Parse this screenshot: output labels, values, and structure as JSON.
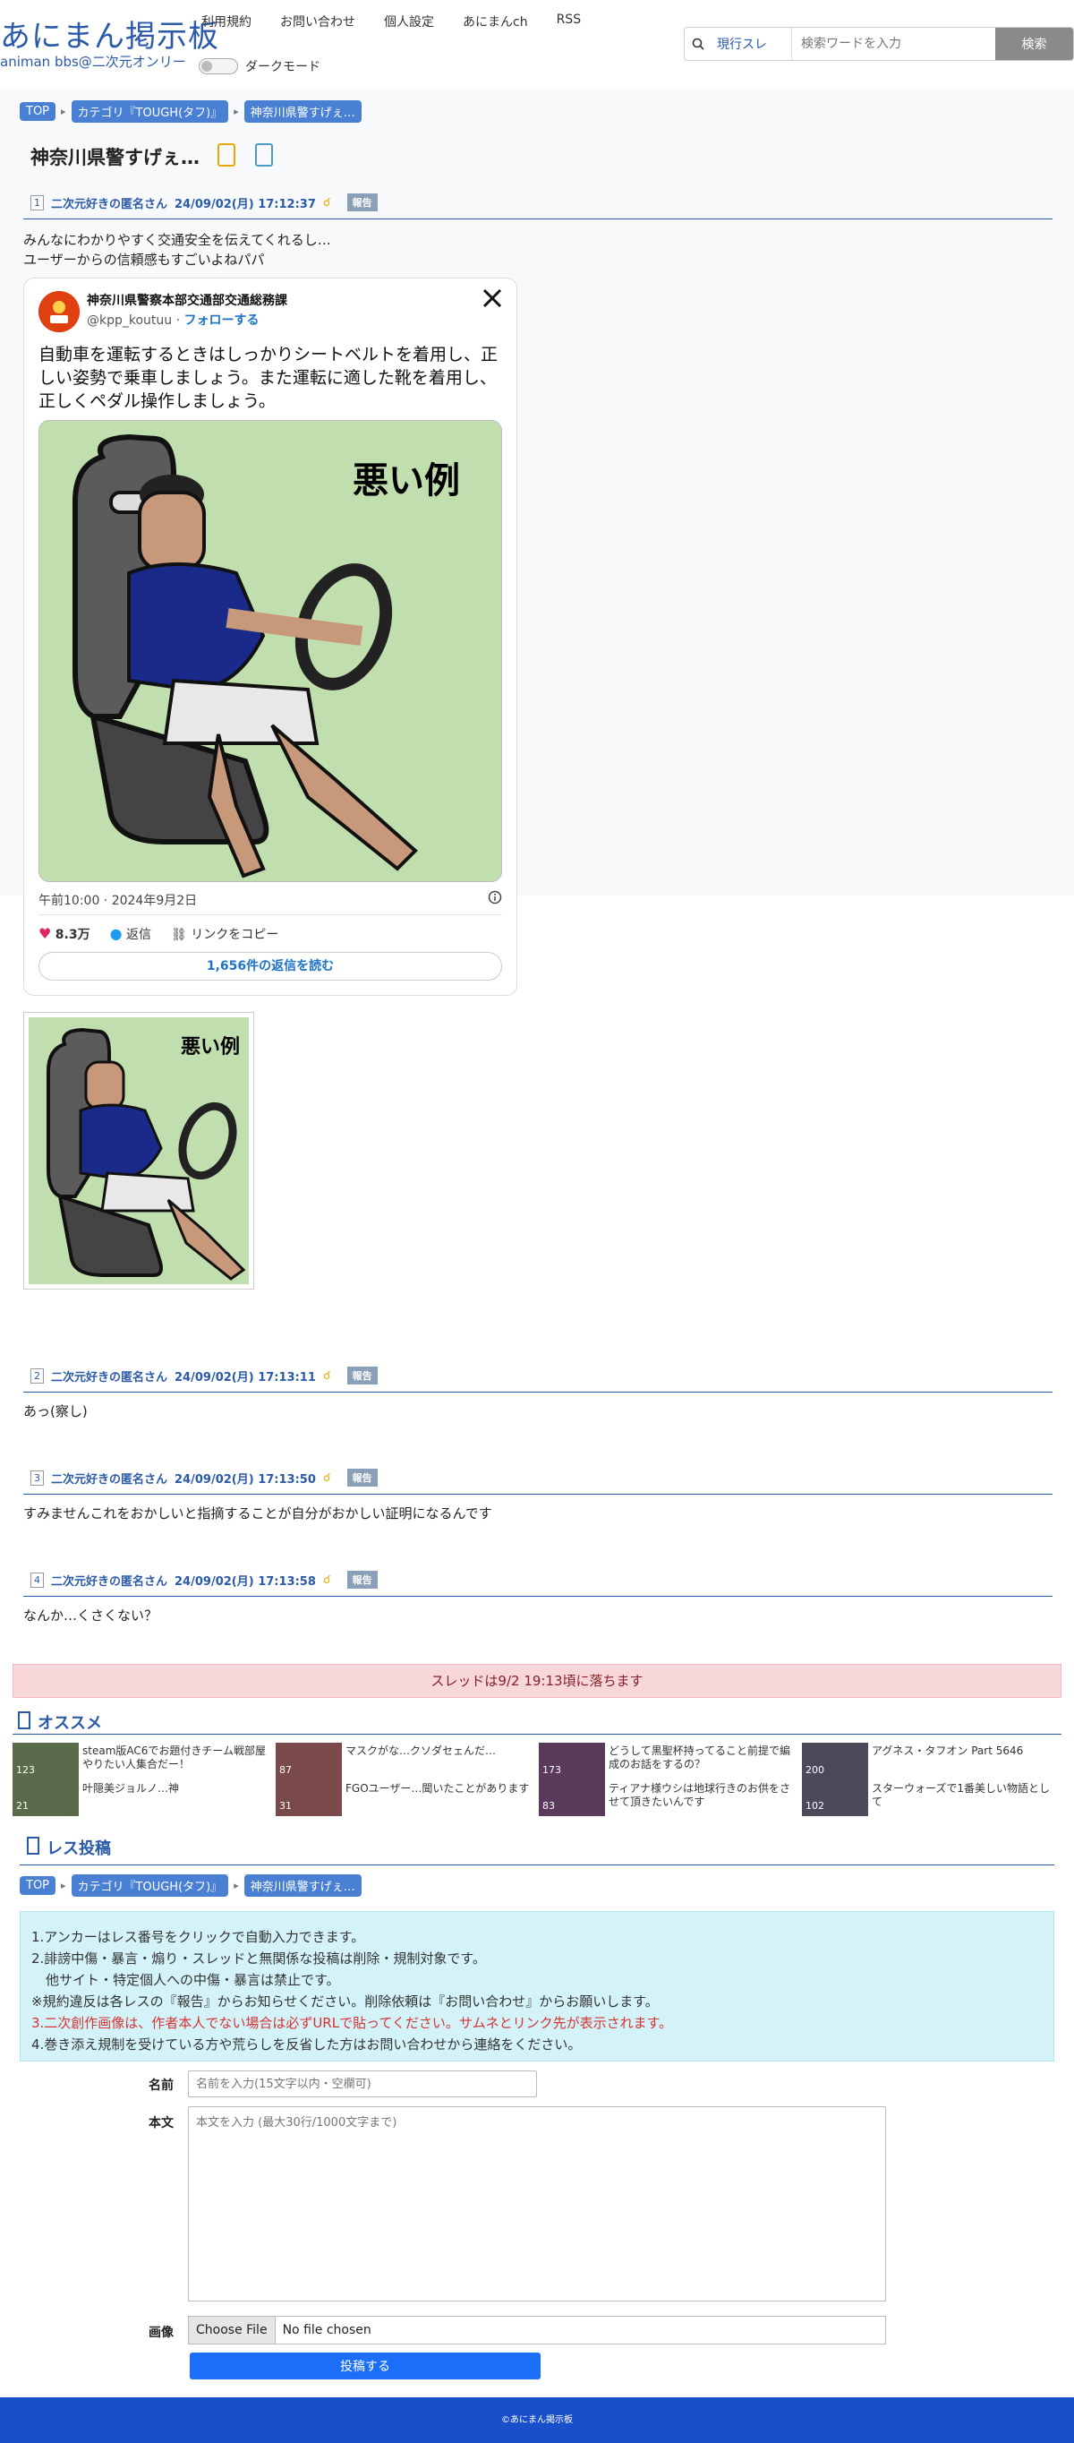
{
  "header": {
    "logo_main": "あにまん掲示板",
    "logo_sub": "animan bbs@二次元オンリー",
    "nav": [
      "利用規約",
      "お問い合わせ",
      "個人設定",
      "あにまんch",
      "RSS"
    ],
    "dark_mode_label": "ダークモード",
    "search_scope": "現行スレ",
    "search_placeholder": "検索ワードを入力",
    "search_button": "検索"
  },
  "breadcrumb": [
    "TOP",
    "カテゴリ『TOUGH(タフ)』",
    "神奈川県警すげぇ…"
  ],
  "thread": {
    "title": "神奈川県警すげぇ…",
    "expire_notice": "スレッドは9/2 19:13頃に落ちます"
  },
  "posts": [
    {
      "num": "1",
      "name": "二次元好きの匿名さん",
      "date": "24/09/02(月) 17:12:37",
      "report": "報告",
      "lines": [
        "みんなにわかりやすく交通安全を伝えてくれるし…",
        "ユーザーからの信頼感もすごいよねパパ"
      ]
    },
    {
      "num": "2",
      "name": "二次元好きの匿名さん",
      "date": "24/09/02(月) 17:13:11",
      "report": "報告",
      "lines": [
        "あっ(察し)"
      ]
    },
    {
      "num": "3",
      "name": "二次元好きの匿名さん",
      "date": "24/09/02(月) 17:13:50",
      "report": "報告",
      "lines": [
        "すみませんこれをおかしいと指摘することが自分がおかしい証明になるんです"
      ]
    },
    {
      "num": "4",
      "name": "二次元好きの匿名さん",
      "date": "24/09/02(月) 17:13:58",
      "report": "報告",
      "lines": [
        "なんか…くさくない？"
      ]
    }
  ],
  "tweet": {
    "author": "神奈川県警察本部交通部交通総務課",
    "handle": "@kpp_koutuu",
    "follow": "フォローする",
    "text": "自動車を運転するときはしっかりシートベルトを着用し、正しい姿勢で乗車しましょう。また運転に適した靴を着用し、正しくペダル操作しましょう。",
    "image_caption": "悪い例",
    "time": "午前10:00 · 2024年9月2日",
    "likes": "8.3万",
    "reply_label": "返信",
    "copy_link_label": "リンクをコピー",
    "read_replies": "1,656件の返信を読む"
  },
  "recommend": {
    "heading": "オススメ",
    "items": [
      {
        "title1": "steam版AC6でお題付きチーム戦部屋やりたい人集合だー！",
        "count1": "123",
        "title2": "叶隠美ジョルノ…神",
        "count2": "21"
      },
      {
        "title1": "マスクがな…クソダセェんだ…",
        "count1": "87",
        "title2": "FGOユーザー…聞いたことがあります",
        "count2": "31"
      },
      {
        "title1": "どうして黒聖杯持ってること前提で編成のお話をするの？",
        "count1": "173",
        "title2": "ティアナ様ウシは地球行きのお供をさせて頂きたいんです",
        "count2": "83"
      },
      {
        "title1": "アグネス・タフオン Part 5646",
        "count1": "200",
        "title2": "スターウォーズで1番美しい物語として",
        "count2": "102"
      }
    ]
  },
  "reply_form": {
    "heading": "レス投稿",
    "rules": [
      "1.アンカーはレス番号をクリックで自動入力できます。",
      "2.誹謗中傷・暴言・煽り・スレッドと無関係な投稿は削除・規制対象です。",
      "他サイト・特定個人への中傷・暴言は禁止です。",
      "※規約違反は各レスの『報告』からお知らせください。削除依頼は『お問い合わせ』からお願いします。",
      "3.二次創作画像は、作者本人でない場合は必ずURLで貼ってください。サムネとリンク先が表示されます。",
      "4.巻き添え規制を受けている方や荒らしを反省した方はお問い合わせから連絡をください。"
    ],
    "name_label": "名前",
    "name_placeholder": "名前を入力(15文字以内・空欄可)",
    "body_label": "本文",
    "body_placeholder": "本文を入力 (最大30行/1000文字まで)",
    "image_label": "画像",
    "file_button": "Choose File",
    "file_none": "No file chosen",
    "submit": "投稿する"
  },
  "footer": {
    "text": "©あにまん掲示板"
  },
  "colors": {
    "accent": "#2a5aa8",
    "crumb": "#4a80d4",
    "notice_bg": "#f8d7da",
    "rules_bg": "#d3f3f9",
    "submit": "#1a6ef7",
    "footer": "#1a4fcc"
  },
  "icons": [
    "search-icon",
    "star-icon",
    "bookmark-icon",
    "thumb-icon",
    "x-logo-icon",
    "heart-icon",
    "reply-icon",
    "link-icon",
    "info-icon",
    "recommend-icon",
    "post-icon"
  ]
}
